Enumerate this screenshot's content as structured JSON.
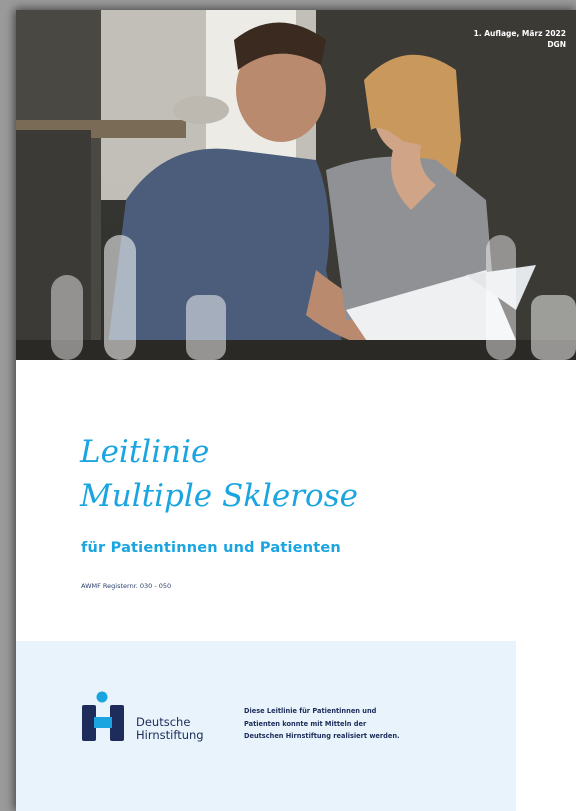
{
  "edition": {
    "line1": "1. Auflage, März 2022",
    "line2": "DGN"
  },
  "title": {
    "line1": "Leitlinie",
    "line2": "Multiple Sklerose"
  },
  "subtitle": "für Patientinnen und Patienten",
  "register": "AWMF Registernr. 030 - 050",
  "logo": {
    "name_line1": "Deutsche",
    "name_line2": "Hirnstiftung",
    "icon": "deutsche-hirnstiftung-logo-icon"
  },
  "sponsor_note": {
    "line1": "Diese Leitlinie für Patientinnen und",
    "line2": "Patienten konnte mit Mitteln der",
    "line3": "Deutschen Hirnstiftung realisiert werden."
  },
  "colors": {
    "accent_blue": "#1aa5e0",
    "navy": "#1d2c5b",
    "band": "#e8f3fb"
  }
}
